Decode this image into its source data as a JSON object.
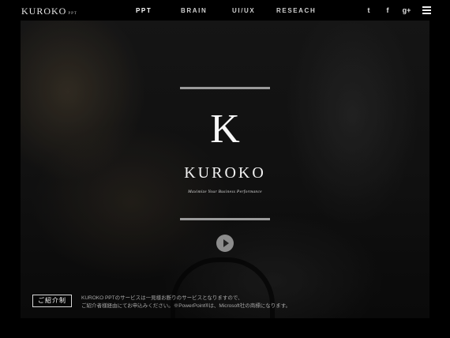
{
  "header": {
    "logo": "KUROKO",
    "logo_sub": "PPT",
    "nav": [
      "PPT",
      "BRAIN",
      "UI/UX",
      "RESEACH"
    ],
    "social": {
      "twitter": "t",
      "facebook": "f",
      "googleplus": "g+"
    }
  },
  "hero": {
    "mark": "K",
    "brand": "KUROKO",
    "tagline": "Maximize Your Business Performance"
  },
  "intro": {
    "button": "ご紹介制",
    "line1": "KUROKO PPTのサービスは一見様お断りのサービスとなりますので、",
    "line2": "ご紹介者様経由にてお申込みください。※PowerPoint®は、Microsoft社の商標になります。"
  },
  "icons": {
    "twitter": "twitter-icon",
    "facebook": "facebook-icon",
    "googleplus": "google-plus-icon",
    "menu": "hamburger-menu-icon",
    "play": "play-icon"
  }
}
